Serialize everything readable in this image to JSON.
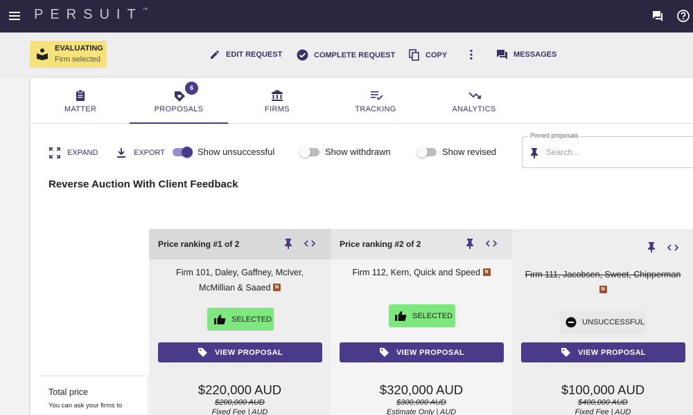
{
  "topbar": {
    "brand": "PERSUIT",
    "trademark": "™",
    "icons": [
      "menu-icon",
      "chat-icon",
      "help-icon"
    ]
  },
  "status": {
    "title": "EVALUATING",
    "subtitle": "Firm selected",
    "color": "#f5e27a"
  },
  "actions": {
    "edit": "EDIT REQUEST",
    "complete": "COMPLETE REQUEST",
    "copy": "COPY",
    "messages": "MESSAGES"
  },
  "tabs": [
    {
      "label": "MATTER",
      "icon": "clipboard-icon"
    },
    {
      "label": "PROPOSALS",
      "icon": "tag-heart-icon",
      "badge": "6"
    },
    {
      "label": "FIRMS",
      "icon": "bank-icon"
    },
    {
      "label": "TRACKING",
      "icon": "checklist-icon"
    },
    {
      "label": "ANALYTICS",
      "icon": "trend-down-icon"
    }
  ],
  "toolbar": {
    "expand": "EXPAND",
    "export": "EXPORT",
    "show_unsuccessful": "Show unsuccessful",
    "show_withdrawn": "Show withdrawn",
    "show_revised": "Show revised"
  },
  "pinned": {
    "label": "Pinned proposals",
    "placeholder": "Search..."
  },
  "section_title": "Reverse Auction With Client Feedback",
  "total": {
    "title": "Total price",
    "subtitle": "You can ask your firms to"
  },
  "proposals": [
    {
      "ranking": "Price ranking #1 of 2",
      "firm_line1": "Firm 101, Daley, Gaffney, McIver,",
      "firm_line2": "McMillian & Saaed",
      "firm_badge": "N",
      "status": "SELECTED",
      "view": "VIEW PROPOSAL",
      "price": "$220,000 AUD",
      "old_price": "$200,000 AUD",
      "fee_type": "Fixed Fee | AUD"
    },
    {
      "ranking": "Price ranking #2 of 2",
      "firm_line1": "Firm 112, Kern, Quick and Speed",
      "firm_badge": "N",
      "status": "SELECTED",
      "view": "VIEW PROPOSAL",
      "price": "$320,000 AUD",
      "old_price": "$300,000 AUD",
      "fee_type": "Estimate Only | AUD"
    },
    {
      "ranking": "",
      "firm_line1": "Firm 111, Jacobsen, Sweet, Chipperman",
      "firm_badge": "N",
      "status": "UNSUCCESSFUL",
      "view": "VIEW PROPOSAL",
      "price": "$100,000 AUD",
      "old_price": "$400,000 AUD",
      "fee_type": "Fixed Fee | AUD"
    }
  ],
  "colors": {
    "topbar": "#2b2740",
    "primary": "#4b3a8a",
    "selected_green": "#7ee77e"
  }
}
